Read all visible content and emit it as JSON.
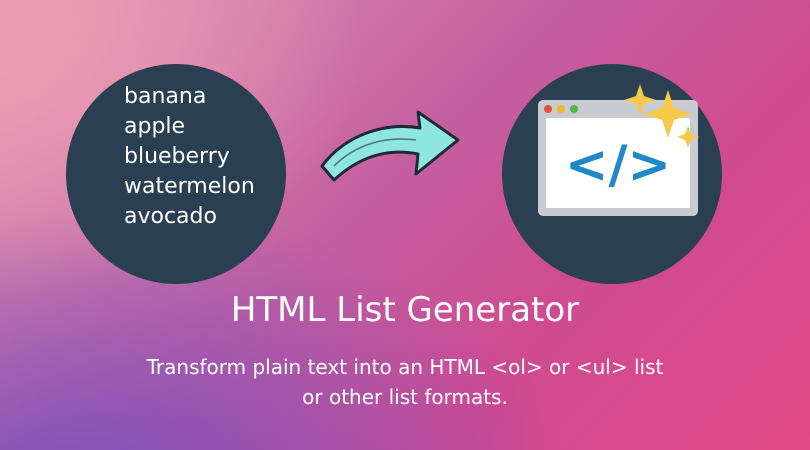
{
  "illustration": {
    "fruits": [
      "banana",
      "apple",
      "blueberry",
      "watermelon",
      "avocado"
    ],
    "code_symbol": "</>",
    "icons": [
      "curved-arrow-icon",
      "browser-window-icon",
      "sparkle-icon"
    ]
  },
  "title": "HTML List Generator",
  "subtitle_line1": "Transform plain text into an HTML <ol> or <ul> list",
  "subtitle_line2": "or other list formats.",
  "colors": {
    "circle": "#2b3f52",
    "arrow": "#8ee6dc",
    "code_blue": "#1f88c9",
    "sparkle": "#f6c94a",
    "window_frame": "#c8cbd0",
    "window_body": "#ffffff",
    "dot_red": "#e0503c",
    "dot_yellow": "#f2b630",
    "dot_green": "#54b048"
  }
}
